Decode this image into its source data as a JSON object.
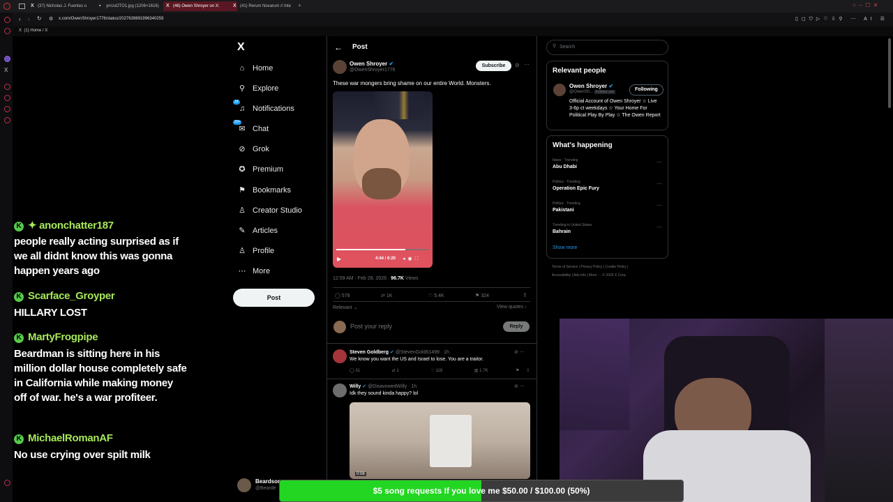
{
  "browser": {
    "tabs": [
      {
        "label": "(37) Nicholas J. Fuentes o"
      },
      {
        "label": "ynUuOTO1.jpg (1206×1616)"
      },
      {
        "label": "(46) Owen Shroyer on X:"
      },
      {
        "label": "(41) Rerum Novarum // Inte"
      }
    ],
    "url": "x.com/OwenShroyer1776/status/2027639891996340259",
    "bookmark": "(1) Home / X"
  },
  "nav": {
    "items": [
      {
        "label": "Home",
        "icon": "home-icon",
        "glyph": "⌂"
      },
      {
        "label": "Explore",
        "icon": "search-icon",
        "glyph": "⚲"
      },
      {
        "label": "Notifications",
        "icon": "bell-icon",
        "glyph": "♫",
        "badge": "18"
      },
      {
        "label": "Chat",
        "icon": "chat-icon",
        "glyph": "✉",
        "badge": "20+"
      },
      {
        "label": "Grok",
        "icon": "grok-icon",
        "glyph": "⊘"
      },
      {
        "label": "Premium",
        "icon": "premium-icon",
        "glyph": "✪"
      },
      {
        "label": "Bookmarks",
        "icon": "bookmark-icon",
        "glyph": "⚑"
      },
      {
        "label": "Creator Studio",
        "icon": "creator-studio-icon",
        "glyph": "♙"
      },
      {
        "label": "Articles",
        "icon": "articles-icon",
        "glyph": "✎"
      },
      {
        "label": "Profile",
        "icon": "profile-icon",
        "glyph": "♙"
      },
      {
        "label": "More",
        "icon": "more-icon",
        "glyph": "⋯"
      }
    ],
    "post_label": "Post",
    "account_name": "Beardson",
    "account_handle": "@Bearde"
  },
  "post": {
    "header": "Post",
    "author_name": "Owen Shroyer",
    "author_handle": "@OwenShroyer1776",
    "subscribe_label": "Subscribe",
    "text": "These war mongers bring shame on our entire World. Monsters.",
    "video_time": "4:44 / 6:20",
    "timestamp": "12:59 AM · Feb 28, 2026 · ",
    "views_count": "96.7K",
    "views_label": " Views",
    "replies": "578",
    "reposts": "1K",
    "likes": "5.4K",
    "bookmarks": "324",
    "sort_label": "Relevant",
    "view_quotes": "View quotes",
    "reply_placeholder": "Post your reply",
    "reply_button": "Reply"
  },
  "replies": [
    {
      "name": "Steven Goldberg",
      "handle": "@StevenGold61499 · 1h",
      "text": "We know you want the US and Israel to lose.  You are a traitor.",
      "replies": "31",
      "reposts": "1",
      "likes": "118",
      "views": "1.7K"
    },
    {
      "name": "Willy",
      "handle": "@DisavowedWilly · 1h",
      "text": "Idk they sound kinda happy? lol",
      "video_time": "0:08"
    }
  ],
  "sidebar": {
    "search_placeholder": "Search",
    "relevant_title": "Relevant people",
    "person_name": "Owen Shroyer",
    "person_handle": "@OwenSh...",
    "follows_you": "Follows you",
    "following_label": "Following",
    "person_bio": "Official Account of Owen Shroyer ☆ Live 3-6p ct weekdays ☆ Your Home For Political Play By Play ☆ The Owen Report",
    "happening_title": "What's happening",
    "trends": [
      {
        "context": "News · Trending",
        "topic": "Abu Dhabi"
      },
      {
        "context": "Politics · Trending",
        "topic": "Operation Epic Fury"
      },
      {
        "context": "Politics · Trending",
        "topic": "Pakistani"
      },
      {
        "context": "Trending in United States",
        "topic": "Bahrain"
      }
    ],
    "show_more": "Show more",
    "footer1": "Terms of Service  |  Privacy Policy  |  Cookie Policy  |",
    "footer2": "Accessibility  |  Ads info  |  More ···  © 2026 X Corp."
  },
  "chat": [
    {
      "user": "✦ anonchatter187",
      "message": "people really acting surprised as if we all didnt know this was gonna happen years ago"
    },
    {
      "user": "Scarface_Groyper",
      "message": "HILLARY LOST"
    },
    {
      "user": "MartyFrogpipe",
      "message": "Beardman is sitting here in his million dollar house completely safe in California while making money off of war. he's a war profiteer."
    },
    {
      "user": "MichaelRomanAF",
      "message": "No use crying over spilt milk"
    }
  ],
  "goal": {
    "text": "$5 song requests If you love me $50.00 / $100.00 (50%)",
    "progress": 0.5
  },
  "colors": {
    "accent": "#1d9bf0",
    "goal_fill": "#22d622",
    "chat_name": "#a6e85a",
    "active_tab": "#5a1622"
  }
}
